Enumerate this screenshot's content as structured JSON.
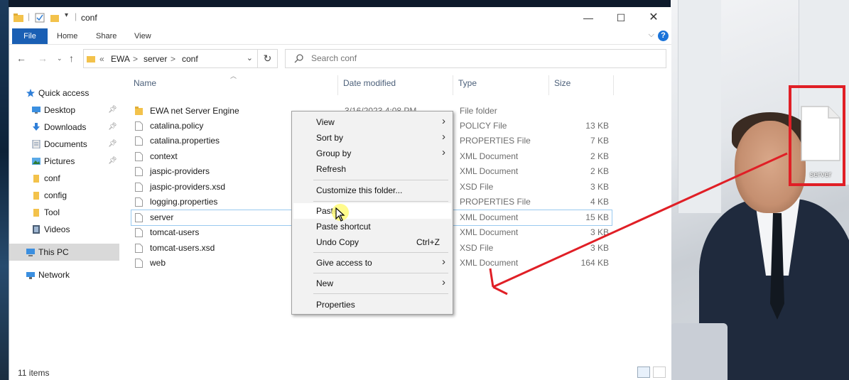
{
  "window": {
    "title": "conf",
    "status_count": "11 items"
  },
  "ribbon": {
    "tabs": [
      "File",
      "Home",
      "Share",
      "View"
    ],
    "help": "?"
  },
  "address": {
    "overflow": "«",
    "crumbs": [
      "EWA",
      "server",
      "conf"
    ],
    "separator": ">"
  },
  "search": {
    "placeholder": "Search conf"
  },
  "nav_pane": {
    "items": [
      {
        "label": "Quick access",
        "icon": "star-icon"
      },
      {
        "label": "Desktop",
        "icon": "desktop-icon",
        "pinned": true
      },
      {
        "label": "Downloads",
        "icon": "download-icon",
        "pinned": true
      },
      {
        "label": "Documents",
        "icon": "documents-icon",
        "pinned": true
      },
      {
        "label": "Pictures",
        "icon": "pictures-icon",
        "pinned": true
      },
      {
        "label": "conf",
        "icon": "folder-icon"
      },
      {
        "label": "config",
        "icon": "folder-icon"
      },
      {
        "label": "Tool",
        "icon": "folder-icon"
      },
      {
        "label": "Videos",
        "icon": "videos-icon"
      },
      {
        "label": "This PC",
        "icon": "computer-icon"
      },
      {
        "label": "Network",
        "icon": "network-icon"
      }
    ]
  },
  "columns": {
    "name": "Name",
    "date": "Date modified",
    "type": "Type",
    "size": "Size"
  },
  "files": [
    {
      "name": "EWA net Server Engine",
      "date": "3/16/2023 4:08 PM",
      "type": "File folder",
      "size": "",
      "folder": true
    },
    {
      "name": "catalina.policy",
      "date": "",
      "type": "POLICY File",
      "size": "13 KB"
    },
    {
      "name": "catalina.properties",
      "date": "",
      "type": "PROPERTIES File",
      "size": "7 KB"
    },
    {
      "name": "context",
      "date": "",
      "type": "XML Document",
      "size": "2 KB"
    },
    {
      "name": "jaspic-providers",
      "date": "",
      "type": "XML Document",
      "size": "2 KB"
    },
    {
      "name": "jaspic-providers.xsd",
      "date": "",
      "type": "XSD File",
      "size": "3 KB"
    },
    {
      "name": "logging.properties",
      "date": "",
      "type": "PROPERTIES File",
      "size": "4 KB"
    },
    {
      "name": "server",
      "date": "",
      "type": "XML Document",
      "size": "15 KB"
    },
    {
      "name": "tomcat-users",
      "date": "",
      "type": "XML Document",
      "size": "3 KB"
    },
    {
      "name": "tomcat-users.xsd",
      "date": "",
      "type": "XSD File",
      "size": "3 KB"
    },
    {
      "name": "web",
      "date": "",
      "type": "XML Document",
      "size": "164 KB"
    }
  ],
  "context_menu": {
    "items": [
      {
        "label": "View",
        "submenu": true
      },
      {
        "label": "Sort by",
        "submenu": true
      },
      {
        "label": "Group by",
        "submenu": true
      },
      {
        "label": "Refresh"
      },
      {
        "label": "Customize this folder..."
      },
      {
        "label": "Paste"
      },
      {
        "label": "Paste shortcut"
      },
      {
        "label": "Undo Copy",
        "accel": "Ctrl+Z"
      },
      {
        "label": "Give access to",
        "submenu": true
      },
      {
        "label": "New",
        "submenu": true
      },
      {
        "label": "Properties"
      }
    ],
    "submenu_glyph": "›"
  },
  "desktop": {
    "file_label": "server"
  },
  "colors": {
    "accent": "#1a5fb4",
    "annotation": "#e01f26"
  }
}
